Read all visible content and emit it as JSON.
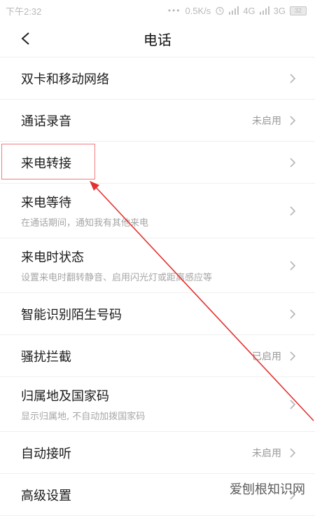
{
  "status_bar": {
    "time": "下午2:32",
    "dots": "•••",
    "network_speed": "0.5K/s",
    "signal_1": "4G",
    "signal_2": "3G",
    "battery": "32"
  },
  "header": {
    "title": "电话",
    "back_icon": "chevron-left-icon"
  },
  "items": [
    {
      "label": "双卡和移动网络",
      "sub": "",
      "status": ""
    },
    {
      "label": "通话录音",
      "sub": "",
      "status": "未启用"
    },
    {
      "label": "来电转接",
      "sub": "",
      "status": ""
    },
    {
      "label": "来电等待",
      "sub": "在通话期间，通知我有其他来电",
      "status": ""
    },
    {
      "label": "来电时状态",
      "sub": "设置来电时翻转静音、启用闪光灯或距离感应等",
      "status": ""
    },
    {
      "label": "智能识别陌生号码",
      "sub": "",
      "status": ""
    },
    {
      "label": "骚扰拦截",
      "sub": "",
      "status": "已启用"
    },
    {
      "label": "归属地及国家码",
      "sub": "显示归属地, 不自动加拨国家码",
      "status": ""
    },
    {
      "label": "自动接听",
      "sub": "",
      "status": "未启用"
    },
    {
      "label": "高级设置",
      "sub": "",
      "status": ""
    }
  ],
  "annotation": {
    "highlight_color": "#f27d7d",
    "arrow_color": "#e2322f"
  },
  "watermark": "爱刨根知识网"
}
